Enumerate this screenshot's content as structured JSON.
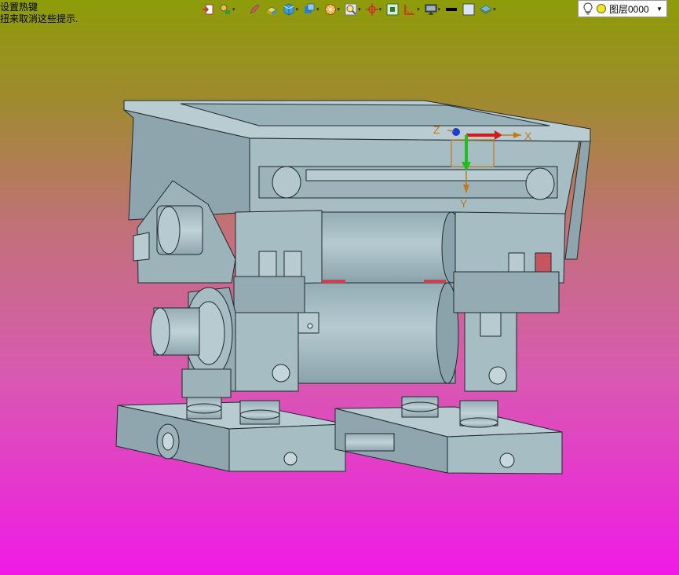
{
  "hint": {
    "line1": "设置热键",
    "line2": "扭来取消这些提示."
  },
  "toolbar": {
    "items": [
      {
        "name": "exit-icon",
        "dropdown": false
      },
      {
        "name": "snap-icon",
        "dropdown": true
      },
      {
        "name": "pencil-icon",
        "dropdown": false
      },
      {
        "name": "eraser-icon",
        "dropdown": false
      },
      {
        "name": "cube-icon",
        "dropdown": true
      },
      {
        "name": "view-cube-icon",
        "dropdown": true
      },
      {
        "name": "render-icon",
        "dropdown": true
      },
      {
        "name": "zoom-icon",
        "dropdown": true
      },
      {
        "name": "crosshair-icon",
        "dropdown": true
      },
      {
        "name": "frame-icon",
        "dropdown": false
      },
      {
        "name": "ruler-icon",
        "dropdown": true
      },
      {
        "name": "monitor-icon",
        "dropdown": true
      },
      {
        "name": "line-style-icon",
        "dropdown": false
      },
      {
        "name": "color-swatch-icon",
        "dropdown": false
      },
      {
        "name": "layers-icon",
        "dropdown": true
      }
    ],
    "dropdown_glyph": "▾"
  },
  "layer": {
    "name": "图层0000",
    "arrow": "▼"
  },
  "triad": {
    "x_label": "X",
    "y_label": "Y",
    "z_label": "Z"
  },
  "colors": {
    "model_fill": "#a7bdc4",
    "model_dark": "#8ca3ab",
    "model_light": "#b9ccd2",
    "edge": "#1f2a2e"
  }
}
